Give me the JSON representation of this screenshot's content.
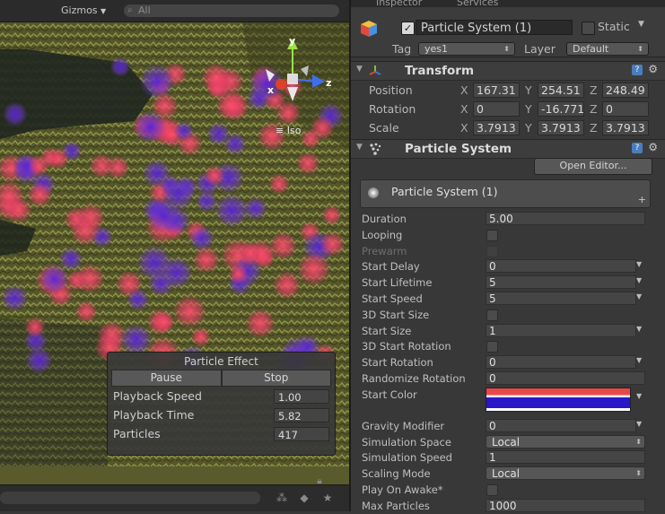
{
  "scene": {
    "gizmos_label": "Gizmos",
    "search_placeholder": "All",
    "axis_x": "x",
    "axis_y": "y",
    "axis_z": "z",
    "persp_label": "Iso"
  },
  "particle_effect": {
    "title": "Particle Effect",
    "pause_label": "Pause",
    "stop_label": "Stop",
    "rows": [
      {
        "label": "Playback Speed",
        "value": "1.00"
      },
      {
        "label": "Playback Time",
        "value": "5.82"
      },
      {
        "label": "Particles",
        "value": "417"
      }
    ]
  },
  "inspector": {
    "tab_label": "Inspector",
    "tab2_label": "Services",
    "object": {
      "name": "Particle System (1)",
      "active": true,
      "static_label": "Static",
      "static_checked": false,
      "tag_label": "Tag",
      "tag_value": "yes1",
      "layer_label": "Layer",
      "layer_value": "Default"
    },
    "transform": {
      "title": "Transform",
      "rows": [
        {
          "label": "Position",
          "x": "167.31",
          "y": "254.51",
          "z": "248.49"
        },
        {
          "label": "Rotation",
          "x": "0",
          "y": "-16.771",
          "z": "0"
        },
        {
          "label": "Scale",
          "x": "3.7913",
          "y": "3.7913",
          "z": "3.7913"
        }
      ]
    },
    "particle_system": {
      "title": "Particle System",
      "open_editor": "Open Editor...",
      "sub_title": "Particle System (1)",
      "props": {
        "duration": {
          "label": "Duration",
          "value": "5.00"
        },
        "looping": {
          "label": "Looping"
        },
        "prewarm": {
          "label": "Prewarm"
        },
        "start_delay": {
          "label": "Start Delay",
          "value": "0"
        },
        "start_lifetime": {
          "label": "Start Lifetime",
          "value": "5"
        },
        "start_speed": {
          "label": "Start Speed",
          "value": "5"
        },
        "start_size_3d": {
          "label": "3D Start Size"
        },
        "start_size": {
          "label": "Start Size",
          "value": "1"
        },
        "start_rotation_3d": {
          "label": "3D Start Rotation"
        },
        "start_rotation": {
          "label": "Start Rotation",
          "value": "0"
        },
        "randomize_rotation": {
          "label": "Randomize Rotation",
          "value": "0"
        },
        "start_color": {
          "label": "Start Color",
          "color_top": "#e84848",
          "color_bottom": "#2a17c8"
        },
        "gravity_modifier": {
          "label": "Gravity Modifier",
          "value": "0"
        },
        "simulation_space": {
          "label": "Simulation Space",
          "value": "Local"
        },
        "simulation_speed": {
          "label": "Simulation Speed",
          "value": "1"
        },
        "scaling_mode": {
          "label": "Scaling Mode",
          "value": "Local"
        },
        "play_on_awake": {
          "label": "Play On Awake*"
        },
        "max_particles": {
          "label": "Max Particles",
          "value": "1000"
        }
      }
    }
  },
  "colors": {
    "particle_red": "#e84a68",
    "particle_blue": "#4a26c8",
    "terrain": "#6b6d30"
  }
}
